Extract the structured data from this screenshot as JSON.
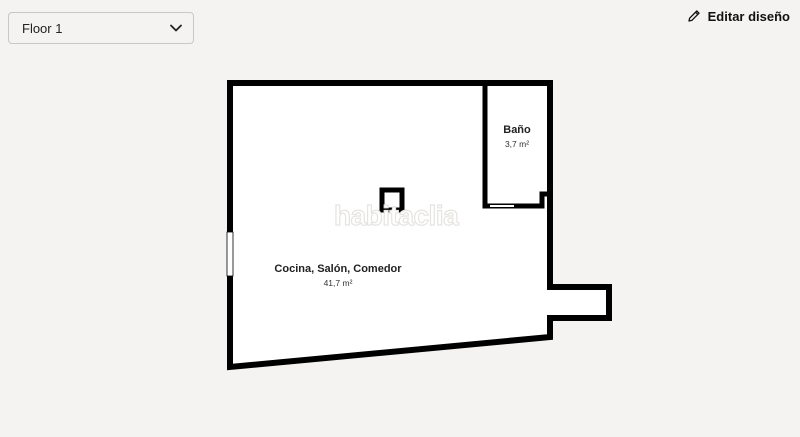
{
  "floor_selector": {
    "value": "Floor 1",
    "icon": "chevron-down-icon"
  },
  "edit_button": {
    "label": "Editar diseño",
    "icon": "pencil-icon"
  },
  "watermark": "habitaclia",
  "rooms": {
    "main": {
      "name": "Cocina, Salón, Comedor",
      "area": "41,7 m²"
    },
    "bath": {
      "name": "Baño",
      "area": "3,7 m²"
    }
  }
}
